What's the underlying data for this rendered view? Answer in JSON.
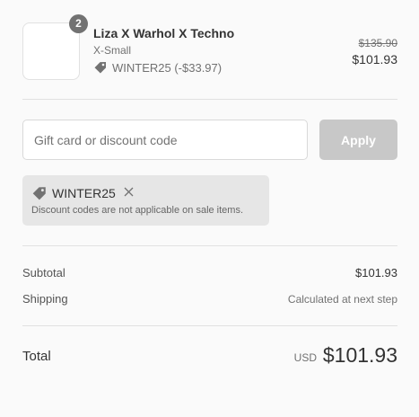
{
  "cart_item": {
    "quantity": "2",
    "name": "Liza X Warhol X Techno",
    "variant": "X-Small",
    "discount_label": "WINTER25 (-$33.97)",
    "price_original": "$135.90",
    "price_final": "$101.93"
  },
  "discount_form": {
    "placeholder": "Gift card or discount code",
    "value": "",
    "apply_label": "Apply"
  },
  "applied_code": {
    "code": "WINTER25",
    "note": "Discount codes are not applicable on sale items."
  },
  "summary": {
    "subtotal_label": "Subtotal",
    "subtotal_value": "$101.93",
    "shipping_label": "Shipping",
    "shipping_value": "Calculated at next step"
  },
  "total": {
    "label": "Total",
    "currency": "USD",
    "amount": "$101.93"
  },
  "icons": {
    "tag": "tag-icon",
    "remove": "close-icon"
  },
  "colors": {
    "apply_disabled": "#c8c8c8",
    "tag_fill": "#727272",
    "applied_bg": "#e6e6e6",
    "qty_badge": "#727272"
  }
}
